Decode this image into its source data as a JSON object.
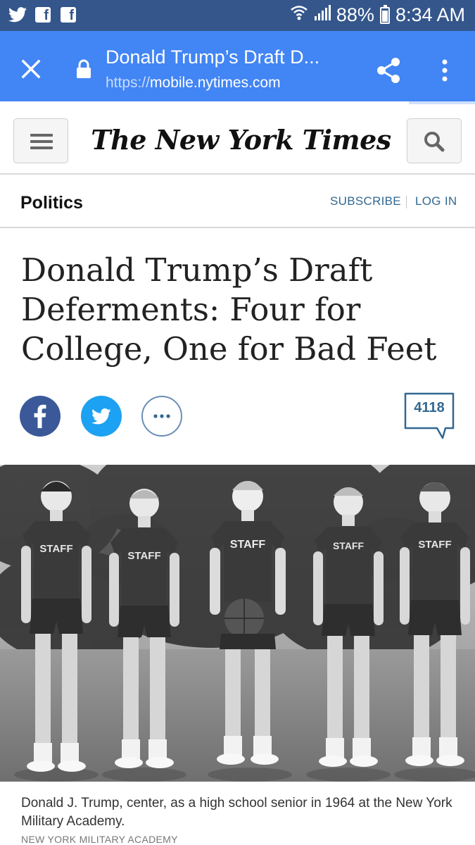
{
  "status_bar": {
    "battery": "88%",
    "battery_level": 0.88,
    "time": "8:34 AM",
    "icons": [
      "twitter-icon",
      "facebook-icon",
      "facebook-icon",
      "wifi-icon",
      "signal-icon",
      "battery-icon"
    ]
  },
  "browser": {
    "title": "Donald Trump’s Draft D...",
    "url_scheme": "https://",
    "url_host": "mobile.nytimes.com",
    "page_load_progress": 0.86,
    "accent_color": "#4285f4"
  },
  "masthead": {
    "logo_text": "The New York Times"
  },
  "section_bar": {
    "section": "Politics",
    "subscribe_label": "SUBSCRIBE",
    "login_label": "LOG IN"
  },
  "article": {
    "headline": "Donald Trump’s Draft Deferments: Four for College, One for Bad Feet",
    "comments_count": "4118",
    "photo_jersey_text": "STAFF",
    "caption": "Donald J. Trump, center, as a high school senior in 1964 at the New York Military Academy.",
    "credit": "NEW YORK MILITARY ACADEMY"
  }
}
